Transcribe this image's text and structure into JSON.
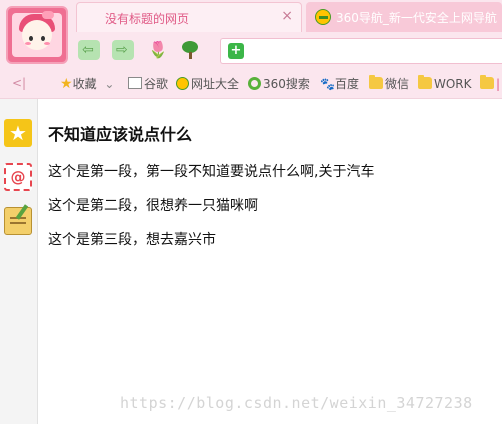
{
  "tabs": {
    "active_title": "没有标题的网页",
    "close_symbol": "×",
    "inactive_title": "360导航_新一代安全上网导航"
  },
  "nav": {
    "back_symbol": "⇦",
    "forward_symbol": "⇨",
    "tulip_symbol": "🌷"
  },
  "address_bar": {
    "value": "",
    "shield_symbol": "+"
  },
  "bookmarks": {
    "collapse_symbol": "<|",
    "items": [
      "收藏",
      "谷歌",
      "网址大全",
      "360搜索",
      "百度",
      "微信",
      "WORK",
      "|"
    ],
    "dropdown_symbol": "⌄"
  },
  "sidebar": {
    "favorites_symbol": "★",
    "mail_symbol": "@"
  },
  "page": {
    "heading": "不知道应该说点什么",
    "paragraphs": [
      "这个是第一段，第一段不知道要说点什么啊,关于汽车",
      "这个是第二段，很想养一只猫咪啊",
      "这个是第三段，想去嘉兴市"
    ]
  },
  "watermark": "https://blog.csdn.net/weixin_34727238",
  "colors": {
    "chrome_bg": "#fbe6ee",
    "tab_text": "#e05a86",
    "accent_green": "#3cb648"
  }
}
